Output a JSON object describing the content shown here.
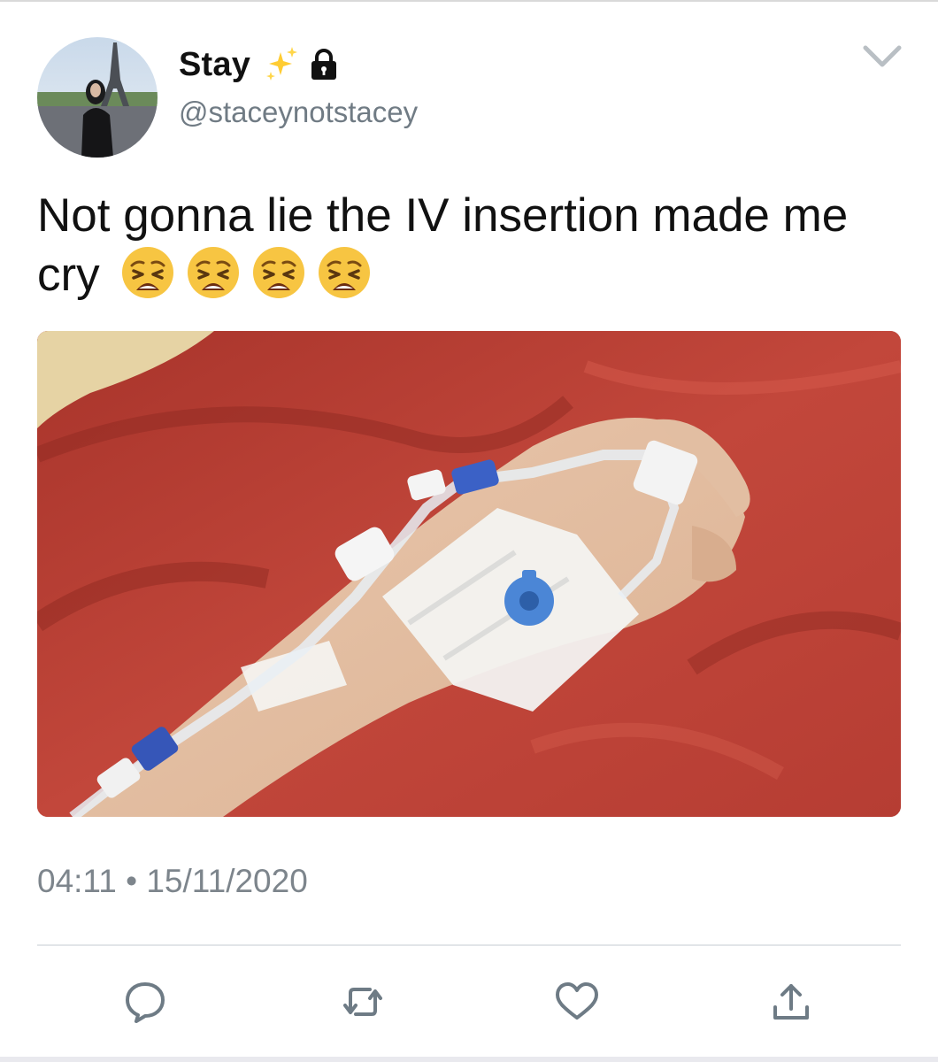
{
  "user": {
    "display_name": "Stay",
    "handle": "@staceynotstacey",
    "name_icons": [
      "sparkles-icon",
      "lock-icon"
    ]
  },
  "tweet": {
    "text": "Not gonna lie the IV insertion made me cry",
    "emojis": [
      "weary-face-emoji",
      "weary-face-emoji",
      "weary-face-emoji",
      "weary-face-emoji"
    ],
    "timestamp": "04:11 • 15/11/2020"
  },
  "actions": [
    "reply-icon",
    "retweet-icon",
    "like-icon",
    "share-icon"
  ],
  "colors": {
    "text": "#111111",
    "secondary": "#707b84",
    "divider": "#e2e5e8",
    "icon": "#6e7b85",
    "blanket": "#b23a30"
  }
}
